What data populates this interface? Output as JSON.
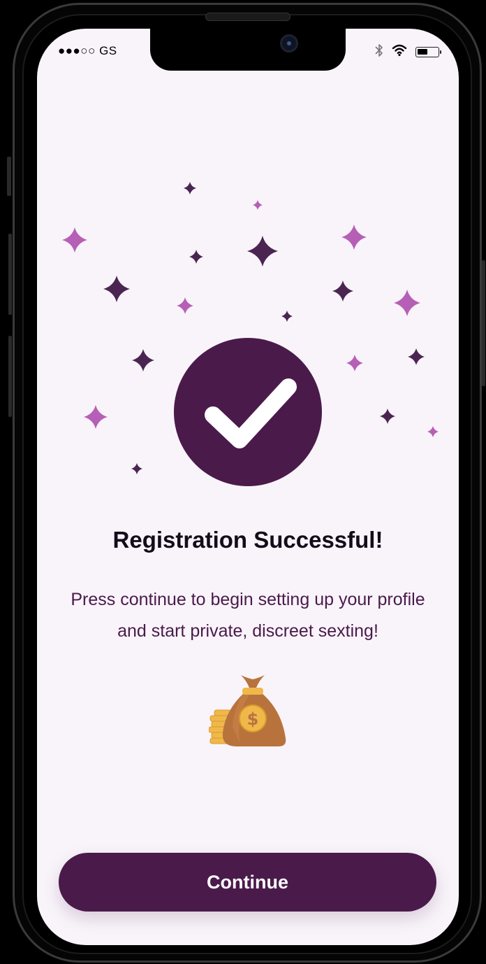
{
  "status_bar": {
    "carrier": "●●●○○ GS",
    "bluetooth_icon": "bluetooth-icon",
    "wifi_icon": "wifi-icon",
    "battery_level": 0.5
  },
  "main": {
    "success_icon": "checkmark-icon",
    "title": "Registration Successful!",
    "subtitle": "Press continue to begin setting up your profile and start private, discreet sexting!",
    "illustration_icon": "money-bag-icon"
  },
  "actions": {
    "continue_label": "Continue"
  },
  "colors": {
    "primary": "#4a1a4b",
    "screen_background": "#f9f4fa",
    "star_dark": "#4a2552",
    "star_pink": "#b65fb6",
    "bag": "#b8733d",
    "coin": "#f0b84a"
  }
}
